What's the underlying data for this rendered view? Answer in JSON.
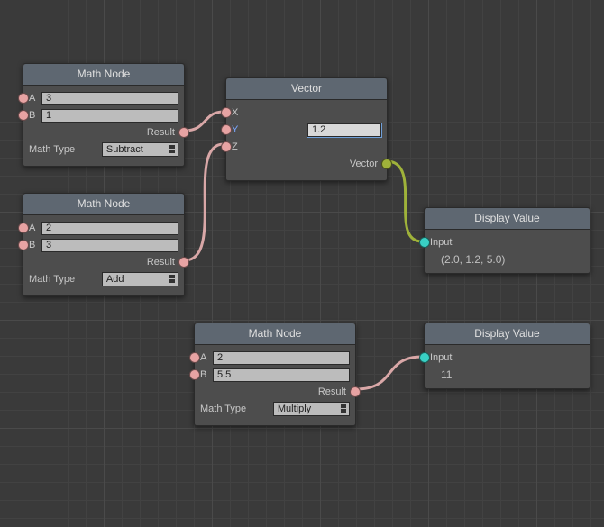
{
  "nodes": {
    "math1": {
      "title": "Math Node",
      "a_label": "A",
      "a_value": "3",
      "b_label": "B",
      "b_value": "1",
      "result_label": "Result",
      "mathtype_label": "Math Type",
      "mathtype_value": "Subtract"
    },
    "math2": {
      "title": "Math Node",
      "a_label": "A",
      "a_value": "2",
      "b_label": "B",
      "b_value": "3",
      "result_label": "Result",
      "mathtype_label": "Math Type",
      "mathtype_value": "Add"
    },
    "math3": {
      "title": "Math Node",
      "a_label": "A",
      "a_value": "2",
      "b_label": "B",
      "b_value": "5.5",
      "result_label": "Result",
      "mathtype_label": "Math Type",
      "mathtype_value": "Multiply"
    },
    "vector": {
      "title": "Vector",
      "x_label": "X",
      "y_label": "Y",
      "y_value": "1.2",
      "z_label": "Z",
      "out_label": "Vector"
    },
    "display1": {
      "title": "Display Value",
      "input_label": "Input",
      "value_text": "(2.0, 1.2, 5.0)"
    },
    "display2": {
      "title": "Display Value",
      "input_label": "Input",
      "value_text": "11"
    }
  },
  "colors": {
    "pink_wire": "#d9a7a7",
    "olive_wire": "#9fb23a"
  }
}
